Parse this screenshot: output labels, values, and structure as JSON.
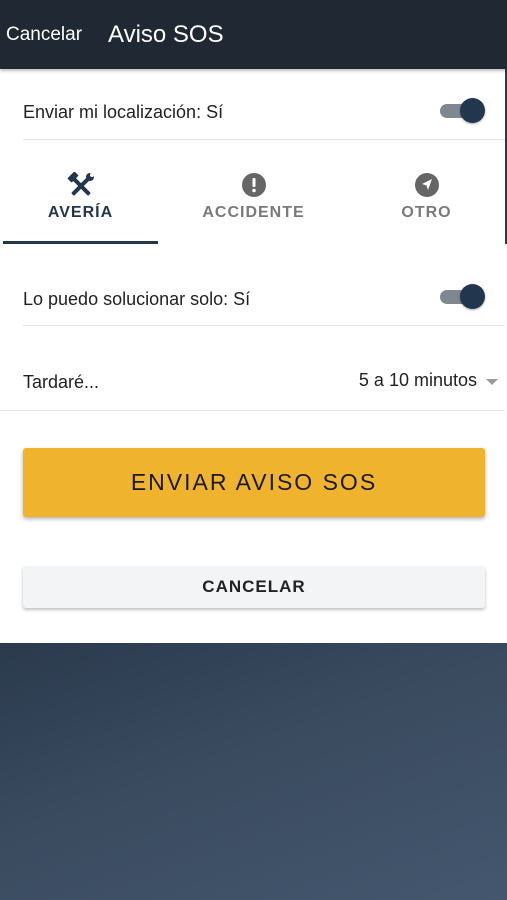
{
  "header": {
    "cancel_label": "Cancelar",
    "title": "Aviso SOS",
    "background": "#1f2833"
  },
  "location_row": {
    "label": "Enviar mi localización: Sí",
    "toggle_on": true
  },
  "tabs": [
    {
      "label": "AVERÍA",
      "icon": "wrench-hammer-icon",
      "active": true
    },
    {
      "label": "ACCIDENTE",
      "icon": "exclamation-circle-icon",
      "active": false
    },
    {
      "label": "OTRO",
      "icon": "navigation-arrow-icon",
      "active": false
    }
  ],
  "solve_row": {
    "label": "Lo puedo solucionar solo: Sí",
    "toggle_on": true
  },
  "eta_row": {
    "label": "Tardaré...",
    "selected_value": "5 a 10 minutos"
  },
  "actions": {
    "send_label": "ENVIAR AVISO SOS",
    "cancel_label": "CANCELAR"
  },
  "colors": {
    "accent": "#22364e",
    "primary_button": "#f0b32e",
    "toggle_track": "#7f8890"
  }
}
